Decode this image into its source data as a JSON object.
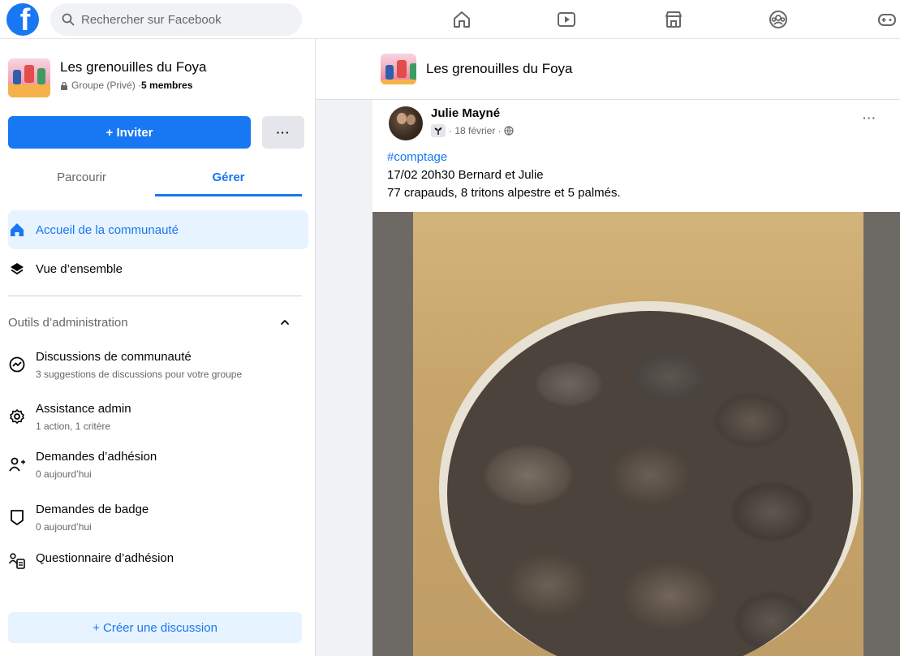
{
  "topbar": {
    "logo_letter": "f",
    "search_placeholder": "Rechercher sur Facebook",
    "nav": [
      "home-icon",
      "video-icon",
      "marketplace-icon",
      "groups-icon",
      "gaming-icon"
    ]
  },
  "group": {
    "name": "Les grenouilles du Foya",
    "privacy": "Groupe (Privé) · ",
    "members": "5 membres"
  },
  "actions": {
    "invite_label": "+ Inviter",
    "more_label": "···"
  },
  "tabs": [
    {
      "label": "Parcourir",
      "active": false
    },
    {
      "label": "Gérer",
      "active": true
    }
  ],
  "menu": {
    "home_label": "Accueil de la communauté",
    "overview_label": "Vue d’ensemble"
  },
  "admin_tools": {
    "title": "Outils d’administration",
    "items": [
      {
        "title": "Discussions de communauté",
        "sub": "3 suggestions de discussions pour votre groupe"
      },
      {
        "title": "Assistance admin",
        "sub": "1 action, 1 critère"
      },
      {
        "title": "Demandes d’adhésion",
        "sub": "0 aujourd’hui"
      },
      {
        "title": "Demandes de badge",
        "sub": "0 aujourd’hui"
      },
      {
        "title": "Questionnaire d’adhésion",
        "sub": ""
      }
    ]
  },
  "create_discussion_label": "+ Créer une discussion",
  "post": {
    "author": "Julie Mayné",
    "date": "· 18 février ·",
    "more_label": "···",
    "hashtag": "#comptage",
    "line1": "17/02 20h30 Bernard et Julie",
    "line2": "77 crapauds,  8 tritons alpestre et 5 palmés."
  },
  "colors": {
    "brand": "#1877f2",
    "active_bg": "#e7f3ff",
    "secondary_text": "#65676b"
  }
}
